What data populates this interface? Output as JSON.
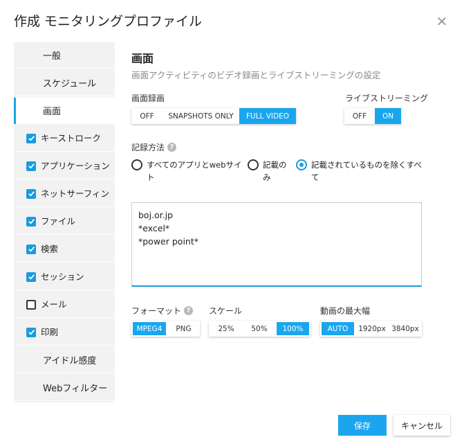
{
  "dialog": {
    "title": "作成 モニタリングプロファイル"
  },
  "sidebar": {
    "items": [
      {
        "label": "一般"
      },
      {
        "label": "スケジュール"
      },
      {
        "label": "画面"
      },
      {
        "label": "キーストローク"
      },
      {
        "label": "アプリケーション"
      },
      {
        "label": "ネットサーフィン"
      },
      {
        "label": "ファイル"
      },
      {
        "label": "検索"
      },
      {
        "label": "セッション"
      },
      {
        "label": "メール"
      },
      {
        "label": "印刷"
      },
      {
        "label": "アイドル感度"
      },
      {
        "label": "Webフィルター"
      }
    ]
  },
  "section": {
    "title": "画面",
    "description": "画面アクティビティのビデオ録画とライブストリーミングの設定"
  },
  "recording": {
    "label": "画面録画",
    "options": [
      "OFF",
      "SNAPSHOTS ONLY",
      "FULL VIDEO"
    ],
    "selected": "FULL VIDEO"
  },
  "streaming": {
    "label": "ライブストリーミング",
    "options": [
      "OFF",
      "ON"
    ],
    "selected": "ON"
  },
  "method": {
    "label": "記録方法",
    "options": [
      {
        "line1": "すべてのアプリとwebサイ",
        "line2": "ト"
      },
      {
        "line1": "記載の",
        "line2": "み"
      },
      {
        "line1": "記載されているものを除くすべ",
        "line2": "て"
      }
    ],
    "selected_index": 2
  },
  "list": {
    "lines": [
      "boj.or.jp",
      "*excel*",
      "*power point*"
    ]
  },
  "format": {
    "label": "フォーマット",
    "options": [
      "MPEG4",
      "PNG"
    ],
    "selected": "MPEG4"
  },
  "scale": {
    "label": "スケール",
    "options": [
      "25%",
      "50%",
      "100%"
    ],
    "selected": "100%"
  },
  "max_width": {
    "label": "動画の最大幅",
    "options": [
      "AUTO",
      "1920px",
      "3840px"
    ],
    "selected": "AUTO"
  },
  "footer": {
    "save_label": "保存",
    "cancel_label": "キャンセル"
  },
  "colors": {
    "accent": "#1aa6ef",
    "sidebar_bg": "#f2f2f2"
  }
}
